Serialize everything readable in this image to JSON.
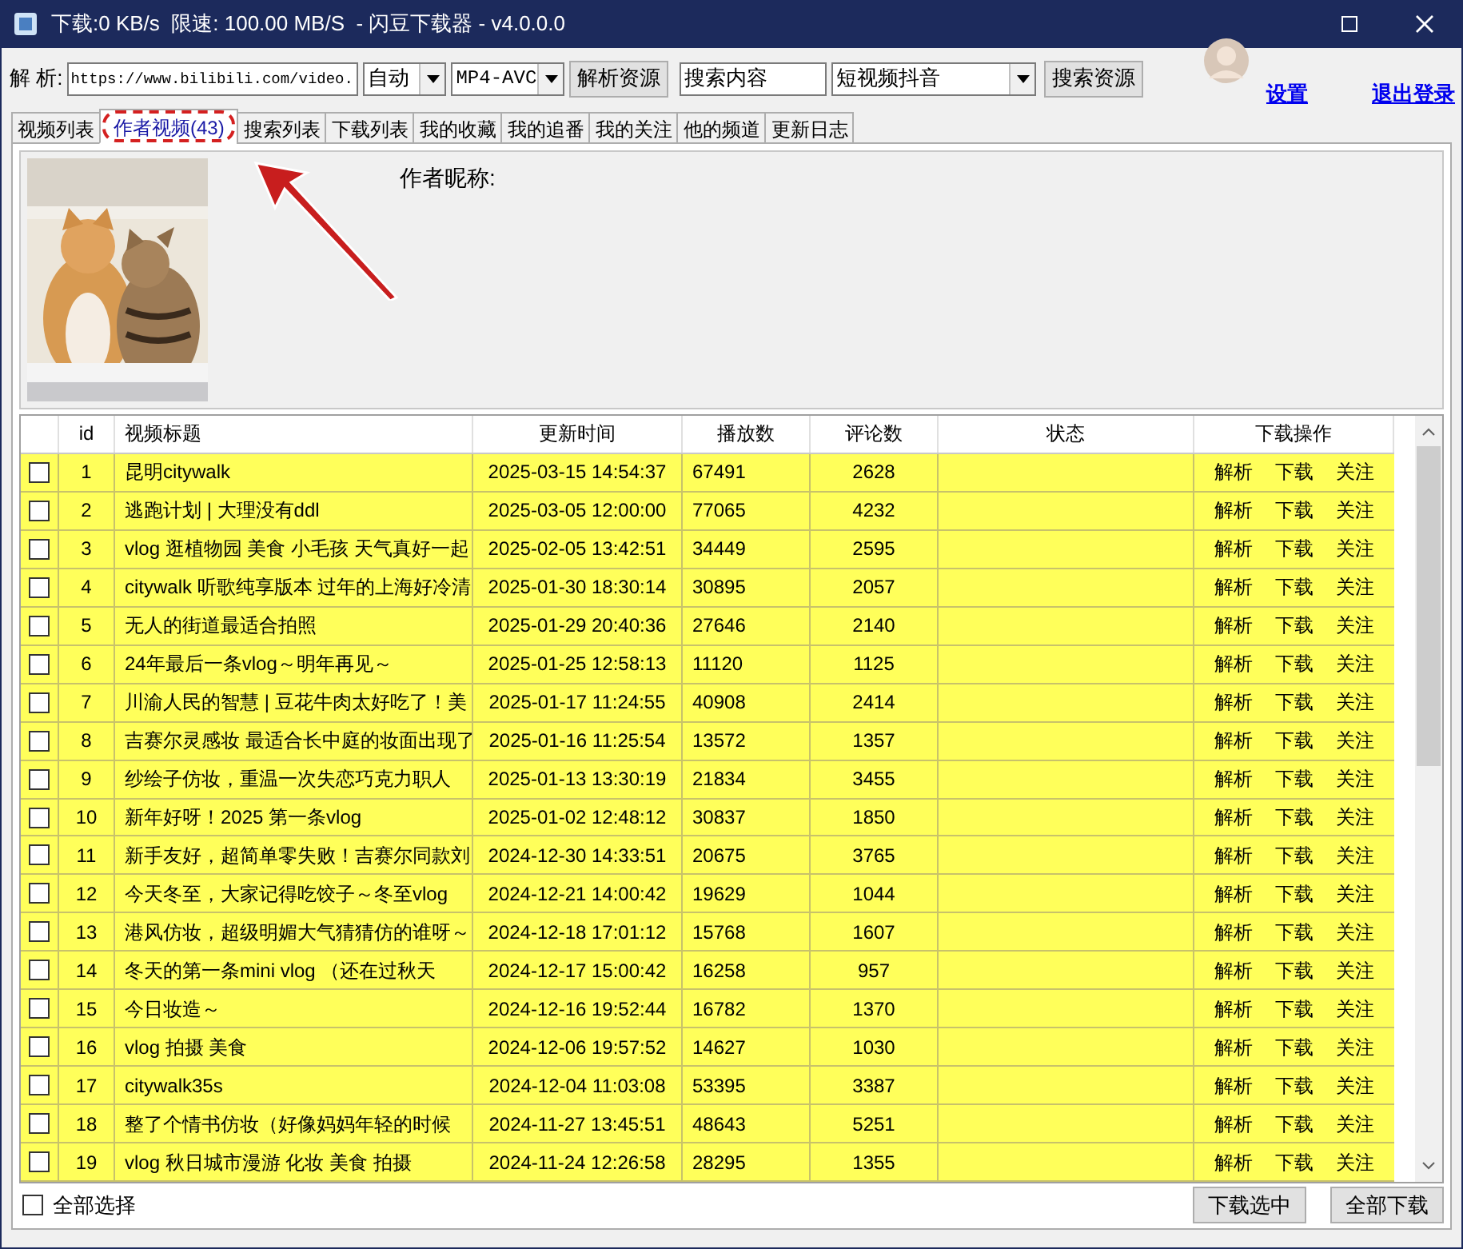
{
  "window": {
    "title": "下载:0 KB/s  限速: 100.00 MB/S  - 闪豆下载器 - v4.0.0.0"
  },
  "toolbar": {
    "parse_label": "解 析:",
    "url": "https://www.bilibili.com/video.",
    "quality": "自动",
    "format": "MP4-AVC",
    "parse_button": "解析资源",
    "search_value": "搜索内容",
    "platform": "短视频抖音",
    "search_button": "搜索资源"
  },
  "account": {
    "links": [
      "设置",
      "退出登录"
    ]
  },
  "tabs": [
    {
      "label": "视频列表",
      "selected": false
    },
    {
      "label": "作者视频(43)",
      "selected": true,
      "highlighted": true
    },
    {
      "label": "搜索列表",
      "selected": false
    },
    {
      "label": "下载列表",
      "selected": false
    },
    {
      "label": "我的收藏",
      "selected": false
    },
    {
      "label": "我的追番",
      "selected": false
    },
    {
      "label": "我的关注",
      "selected": false
    },
    {
      "label": "他的频道",
      "selected": false
    },
    {
      "label": "更新日志",
      "selected": false
    }
  ],
  "author": {
    "name_label": "作者昵称:"
  },
  "table": {
    "columns": [
      "id",
      "视频标题",
      "更新时间",
      "播放数",
      "评论数",
      "状态",
      "下载操作"
    ],
    "rows": [
      {
        "checked": false,
        "id": "1",
        "title": "昆明citywalk",
        "time": "2025-03-15 14:54:37",
        "plays": "67491",
        "comments": "2628",
        "actions": [
          "解析",
          "下载",
          "关注"
        ]
      },
      {
        "checked": false,
        "id": "2",
        "title": "逃跑计划 | 大理没有ddl",
        "time": "2025-03-05 12:00:00",
        "plays": "77065",
        "comments": "4232",
        "actions": [
          "解析",
          "下载",
          "关注"
        ]
      },
      {
        "checked": false,
        "id": "3",
        "title": "vlog 逛植物园 美食 小毛孩 天气真好一起",
        "time": "2025-02-05 13:42:51",
        "plays": "34449",
        "comments": "2595",
        "actions": [
          "解析",
          "下载",
          "关注"
        ]
      },
      {
        "checked": false,
        "id": "4",
        "title": "citywalk 听歌纯享版本 过年的上海好冷清",
        "time": "2025-01-30 18:30:14",
        "plays": "30895",
        "comments": "2057",
        "actions": [
          "解析",
          "下载",
          "关注"
        ]
      },
      {
        "checked": false,
        "id": "5",
        "title": "无人的街道最适合拍照",
        "time": "2025-01-29 20:40:36",
        "plays": "27646",
        "comments": "2140",
        "actions": [
          "解析",
          "下载",
          "关注"
        ]
      },
      {
        "checked": false,
        "id": "6",
        "title": "24年最后一条vlog～明年再见～",
        "time": "2025-01-25 12:58:13",
        "plays": "11120",
        "comments": "1125",
        "actions": [
          "解析",
          "下载",
          "关注"
        ]
      },
      {
        "checked": false,
        "id": "7",
        "title": "川渝人民的智慧 | 豆花牛肉太好吃了！美",
        "time": "2025-01-17 11:24:55",
        "plays": "40908",
        "comments": "2414",
        "actions": [
          "解析",
          "下载",
          "关注"
        ]
      },
      {
        "checked": false,
        "id": "8",
        "title": "吉赛尔灵感妆 最适合长中庭的妆面出现了",
        "time": "2025-01-16 11:25:54",
        "plays": "13572",
        "comments": "1357",
        "actions": [
          "解析",
          "下载",
          "关注"
        ]
      },
      {
        "checked": false,
        "id": "9",
        "title": "纱绘子仿妆，重温一次失恋巧克力职人",
        "time": "2025-01-13 13:30:19",
        "plays": "21834",
        "comments": "3455",
        "actions": [
          "解析",
          "下载",
          "关注"
        ]
      },
      {
        "checked": false,
        "id": "10",
        "title": "新年好呀！2025 第一条vlog",
        "time": "2025-01-02 12:48:12",
        "plays": "30837",
        "comments": "1850",
        "actions": [
          "解析",
          "下载",
          "关注"
        ]
      },
      {
        "checked": false,
        "id": "11",
        "title": "新手友好，超简单零失败！吉赛尔同款刘",
        "time": "2024-12-30 14:33:51",
        "plays": "20675",
        "comments": "3765",
        "actions": [
          "解析",
          "下载",
          "关注"
        ]
      },
      {
        "checked": false,
        "id": "12",
        "title": "今天冬至，大家记得吃饺子～冬至vlog",
        "time": "2024-12-21 14:00:42",
        "plays": "19629",
        "comments": "1044",
        "actions": [
          "解析",
          "下载",
          "关注"
        ]
      },
      {
        "checked": false,
        "id": "13",
        "title": "港风仿妆，超级明媚大气猜猜仿的谁呀～",
        "time": "2024-12-18 17:01:12",
        "plays": "15768",
        "comments": "1607",
        "actions": [
          "解析",
          "下载",
          "关注"
        ]
      },
      {
        "checked": false,
        "id": "14",
        "title": "冬天的第一条mini vlog （还在过秋天",
        "time": "2024-12-17 15:00:42",
        "plays": "16258",
        "comments": "957",
        "actions": [
          "解析",
          "下载",
          "关注"
        ]
      },
      {
        "checked": false,
        "id": "15",
        "title": "今日妆造～",
        "time": "2024-12-16 19:52:44",
        "plays": "16782",
        "comments": "1370",
        "actions": [
          "解析",
          "下载",
          "关注"
        ]
      },
      {
        "checked": false,
        "id": "16",
        "title": "vlog 拍摄 美食",
        "time": "2024-12-06 19:57:52",
        "plays": "14627",
        "comments": "1030",
        "actions": [
          "解析",
          "下载",
          "关注"
        ]
      },
      {
        "checked": false,
        "id": "17",
        "title": "citywalk35s",
        "time": "2024-12-04 11:03:08",
        "plays": "53395",
        "comments": "3387",
        "actions": [
          "解析",
          "下载",
          "关注"
        ]
      },
      {
        "checked": false,
        "id": "18",
        "title": "整了个情书仿妆（好像妈妈年轻的时候",
        "time": "2024-11-27 13:45:51",
        "plays": "48643",
        "comments": "5251",
        "actions": [
          "解析",
          "下载",
          "关注"
        ]
      },
      {
        "checked": false,
        "id": "19",
        "title": "vlog 秋日城市漫游  化妆 美食 拍摄",
        "time": "2024-11-24 12:26:58",
        "plays": "28295",
        "comments": "1355",
        "actions": [
          "解析",
          "下载",
          "关注"
        ]
      }
    ]
  },
  "footer": {
    "select_all": {
      "label": "全部选择",
      "checked": false
    },
    "buttons": [
      "下载选中",
      "全部下载"
    ]
  }
}
